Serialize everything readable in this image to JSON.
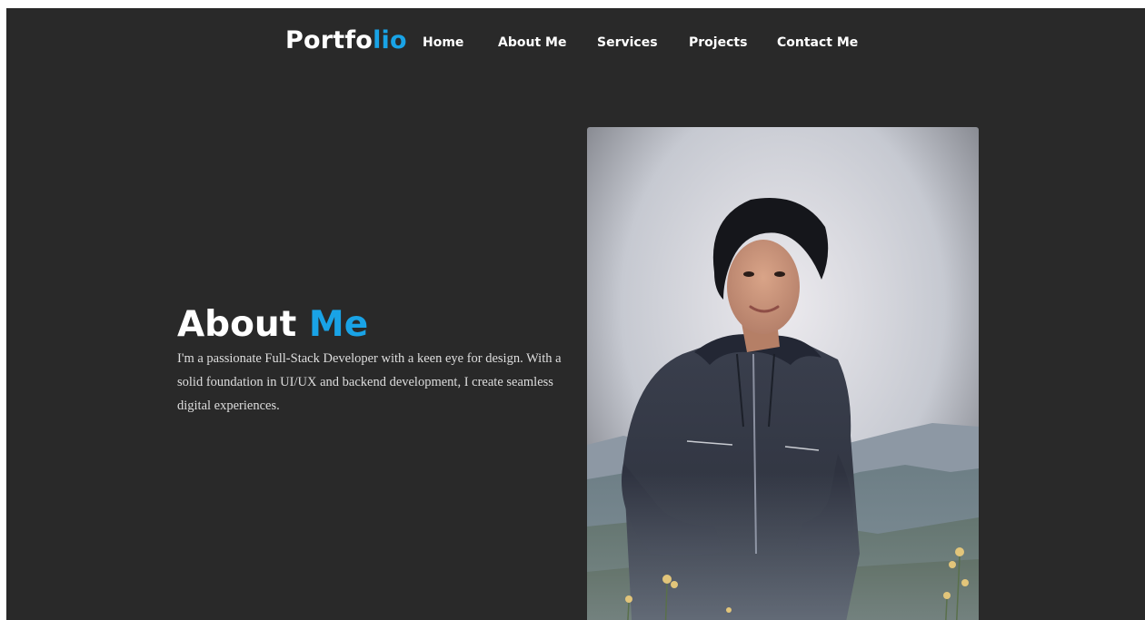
{
  "nav": {
    "logo_main": "Portfo",
    "logo_accent": "lio",
    "links": [
      "Home",
      "About Me",
      "Services",
      "Projects",
      "Contact Me"
    ]
  },
  "about": {
    "title_main": "About",
    "title_accent": "Me",
    "description": "I'm a passionate Full-Stack Developer with a keen eye for design. With a solid foundation in UI/UX and backend development, I create seamless digital experiences."
  },
  "colors": {
    "background": "#292929",
    "accent": "#19a3e6",
    "text": "#ffffff"
  },
  "photo": {
    "icon": "profile-photo"
  }
}
